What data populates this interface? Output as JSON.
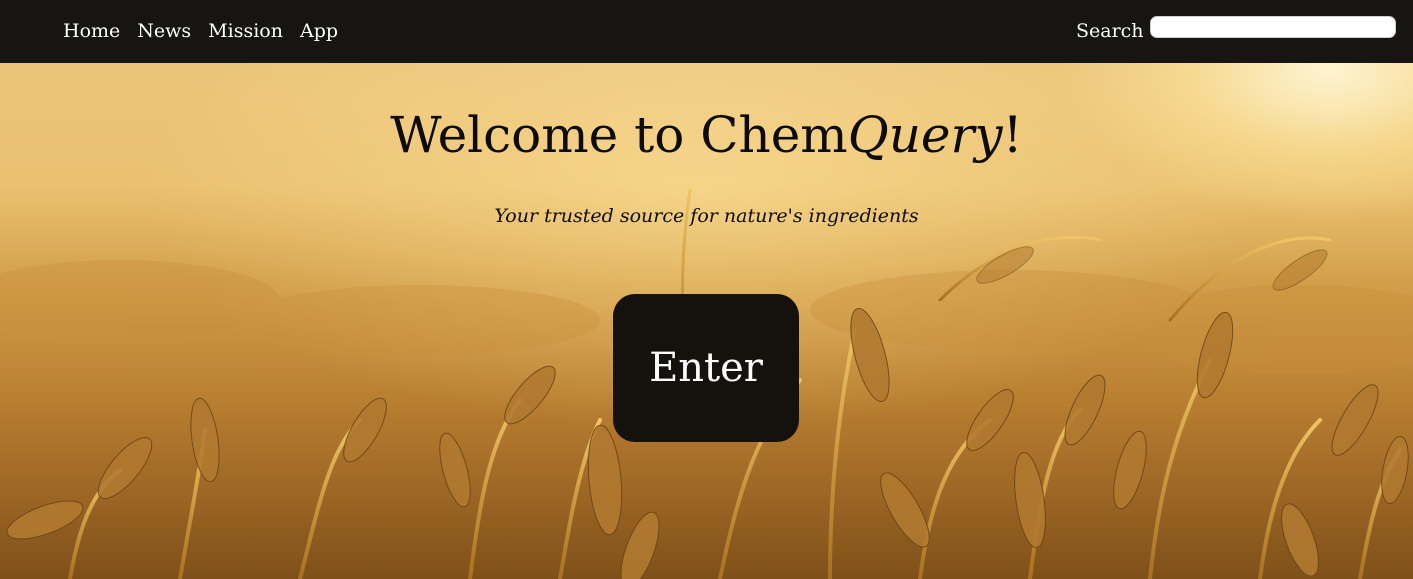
{
  "nav": {
    "items": [
      {
        "label": "Home"
      },
      {
        "label": "News"
      },
      {
        "label": "Mission"
      },
      {
        "label": "App"
      }
    ],
    "search_label": "Search",
    "search_value": ""
  },
  "hero": {
    "title_prefix": "Welcome to Chem",
    "title_emphasis": "Query",
    "title_suffix": "!",
    "tagline": "Your trusted source for nature's ingredients",
    "enter_label": "Enter",
    "background": "wheat-field-photo"
  },
  "colors": {
    "navbar": "#161512",
    "button": "#15120d",
    "text": "#0e0b06"
  }
}
